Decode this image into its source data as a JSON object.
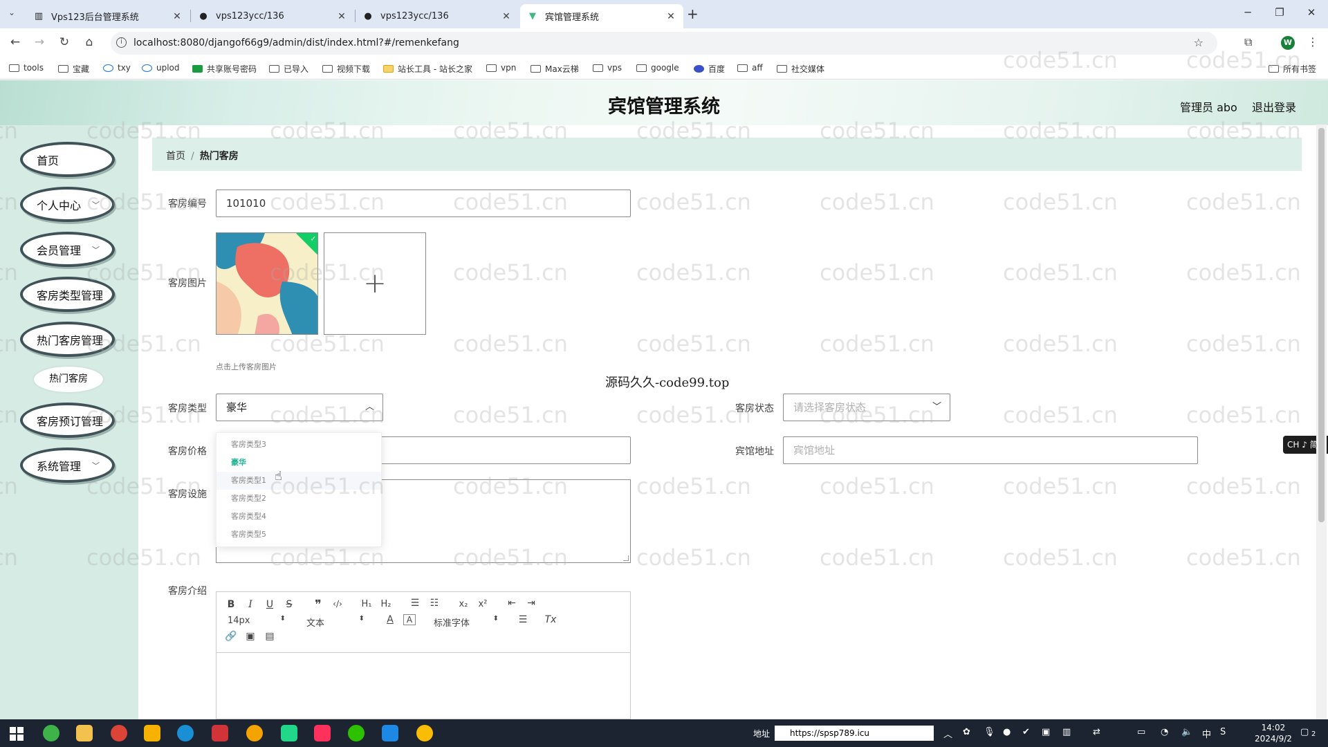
{
  "browser": {
    "tabs": [
      {
        "title": "Vps123后台管理系统",
        "active": false
      },
      {
        "title": "vps123ycc/136",
        "active": false
      },
      {
        "title": "vps123ycc/136",
        "active": false
      },
      {
        "title": "宾馆管理系统",
        "active": true
      }
    ],
    "url": "localhost:8080/djangof66g9/admin/dist/index.html?#/remenkefang",
    "profile_initial": "W",
    "bookmarks": [
      "tools",
      "宝藏",
      "txy",
      "uplod",
      "共享账号密码",
      "已导入",
      "视频下载",
      "站长工具 - 站长之家",
      "vpn",
      "Max云梯",
      "vps",
      "google",
      "百度",
      "aff",
      "社交媒体"
    ],
    "all_bookmarks": "所有书签"
  },
  "app": {
    "title": "宾馆管理系统",
    "admin_label": "管理员 abo",
    "logout": "退出登录"
  },
  "sidebar": {
    "items": [
      {
        "label": "首页",
        "expandable": false
      },
      {
        "label": "个人中心",
        "expandable": true
      },
      {
        "label": "会员管理",
        "expandable": true
      },
      {
        "label": "客房类型管理",
        "expandable": false
      },
      {
        "label": "热门客房管理",
        "expandable": false
      },
      {
        "label": "客房预订管理",
        "expandable": false
      },
      {
        "label": "系统管理",
        "expandable": true
      }
    ],
    "subitem": "热门客房"
  },
  "breadcrumb": {
    "home": "首页",
    "separator": "/",
    "current": "热门客房"
  },
  "form": {
    "room_no_label": "客房编号",
    "room_no_value": "101010",
    "image_label": "客房图片",
    "upload_tip": "点击上传客房图片",
    "room_type_label": "客房类型",
    "room_type_value": "豪华",
    "room_status_label": "客房状态",
    "room_status_placeholder": "请选择客房状态",
    "price_label": "客房价格",
    "address_label": "宾馆地址",
    "address_placeholder": "宾馆地址",
    "facilities_label": "客房设施",
    "intro_label": "客房介绍"
  },
  "dropdown": {
    "options": [
      "客房类型3",
      "豪华",
      "客房类型1",
      "客房类型2",
      "客房类型4",
      "客房类型5"
    ],
    "selected_index": 1,
    "hover_index": 2
  },
  "editor": {
    "font_size": "14px",
    "header": "文本",
    "font_family": "标准字体"
  },
  "overlay": {
    "watermark": "code51.cn",
    "center_watermark": "源码久久-code99.top",
    "ime": "CH ♪ 简"
  },
  "taskbar": {
    "address_label": "地址",
    "address_value": "https://spsp789.icu",
    "time": "14:02",
    "date": "2024/9/2",
    "notifications": "2"
  },
  "colors": {
    "accent": "#1ab394",
    "sidebar_bg": "#d6ebe4",
    "breadcrumb_bg": "#dcefe8"
  }
}
